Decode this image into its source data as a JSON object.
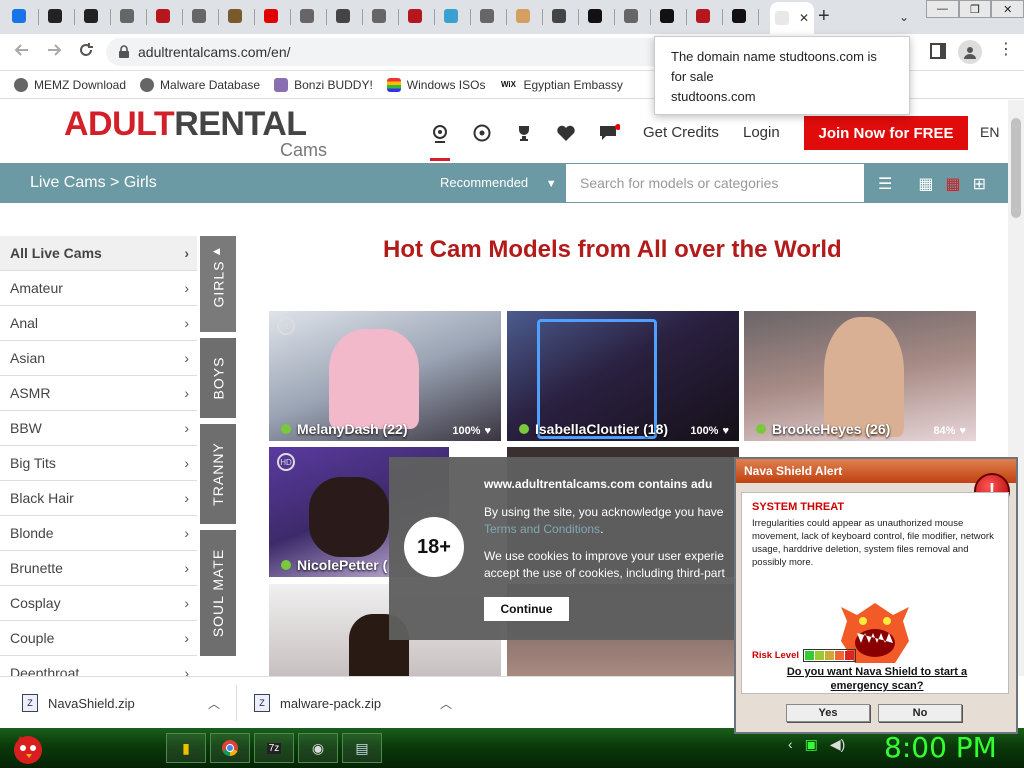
{
  "browser": {
    "tabs": [
      {
        "icon": "download-icon",
        "color": "#1a73e8"
      },
      {
        "icon": "github-icon",
        "color": "#222222"
      },
      {
        "icon": "github-icon",
        "color": "#222222"
      },
      {
        "icon": "globe-icon",
        "color": "#666666"
      },
      {
        "icon": "ublock-icon",
        "color": "#b5171e"
      },
      {
        "icon": "globe-icon",
        "color": "#666666"
      },
      {
        "icon": "image-icon",
        "color": "#7a5a2a"
      },
      {
        "icon": "youtube-icon",
        "color": "#e00000"
      },
      {
        "icon": "globe-icon",
        "color": "#666666"
      },
      {
        "icon": "speaker-icon",
        "color": "#444444"
      },
      {
        "icon": "globe-icon",
        "color": "#666666"
      },
      {
        "icon": "ublock-icon",
        "color": "#b5171e"
      },
      {
        "icon": "s-icon",
        "color": "#3aa0d0"
      },
      {
        "icon": "globe-icon",
        "color": "#666666"
      },
      {
        "icon": "face-icon",
        "color": "#d4a060"
      },
      {
        "icon": "speaker-icon",
        "color": "#444444"
      },
      {
        "icon": "chat-icon",
        "color": "#111111"
      },
      {
        "icon": "globe-icon",
        "color": "#666666"
      },
      {
        "icon": "chat-icon",
        "color": "#111111"
      },
      {
        "icon": "ublock-icon",
        "color": "#b5171e"
      },
      {
        "icon": "porn-icon",
        "color": "#111111"
      },
      {
        "icon": "site-icon",
        "color": "#e8e8e8"
      }
    ],
    "new_tab": "+",
    "tab_search": "⌄",
    "win_controls": [
      "—",
      "❐",
      "✕"
    ],
    "url": "adultrentalcams.com/en/",
    "bookmarks": [
      {
        "label": "MEMZ Download",
        "icon": "globe-icon"
      },
      {
        "label": "Malware Database",
        "icon": "globe-icon"
      },
      {
        "label": "Bonzi BUDDY!",
        "icon": "bonzi-icon"
      },
      {
        "label": "Windows ISOs",
        "icon": "windows-icon"
      },
      {
        "label": "Egyptian Embassy",
        "icon": "wix-icon"
      }
    ],
    "tooltip": {
      "line1": "The domain name studtoons.com is",
      "line2": "for sale",
      "line3": "studtoons.com"
    }
  },
  "site": {
    "logo_adult": "ADULT",
    "logo_rental": "RENTAL",
    "logo_cams": "Cams",
    "get_credits": "Get Credits",
    "login": "Login",
    "join": "Join Now for FREE",
    "lang": "EN",
    "crumb": "Live Cams > Girls",
    "sort": "Recommended",
    "search_placeholder": "Search for models or categories",
    "heading": "Hot Cam Models from All over the World",
    "categories": [
      "All Live Cams",
      "Amateur",
      "Anal",
      "Asian",
      "ASMR",
      "BBW",
      "Big Tits",
      "Black Hair",
      "Blonde",
      "Brunette",
      "Cosplay",
      "Couple",
      "Deepthroat"
    ],
    "side_tabs": [
      "GIRLS",
      "BOYS",
      "TRANNY",
      "SOUL MATE"
    ],
    "models": [
      {
        "name": "MelanyDash (22)",
        "pct": "100%"
      },
      {
        "name": "IsabellaCloutier (18)",
        "pct": "100%"
      },
      {
        "name": "BrookeHeyes (26)",
        "pct": "84%"
      },
      {
        "name": "NicolePetter (",
        "pct": ""
      }
    ]
  },
  "cookie": {
    "age": "18+",
    "title": "www.adultrentalcams.com contains adu",
    "p1a": "By using the site, you acknowledge you have",
    "p1b": "Terms and Conditions",
    "p1c": ".",
    "p2a": "We use cookies to improve your user experie",
    "p2b": "accept the use of cookies, including third-part",
    "continue": "Continue"
  },
  "nava": {
    "title": "Nava Shield Alert",
    "threat": "SYSTEM THREAT",
    "text": "Irregularities could appear as unauthorized mouse movement, lack of keyboard control, file modifier, network usage, harddrive deletion, system files removal and possibly more.",
    "risk": "Risk Level",
    "question": "Do you want Nava Shield to start a emergency scan?",
    "yes": "Yes",
    "no": "No"
  },
  "downloads": [
    {
      "name": "NavaShield.zip"
    },
    {
      "name": "malware-pack.zip"
    }
  ],
  "taskbar": {
    "clock": "8:00 PM"
  }
}
